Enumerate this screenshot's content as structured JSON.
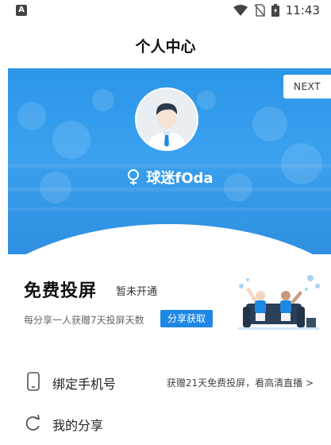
{
  "status_bar": {
    "time": "11:43",
    "left_icon": "notification-a-icon",
    "right_icons": [
      "wifi-icon",
      "no-sim-icon",
      "battery-charging-icon"
    ]
  },
  "header": {
    "title": "个人中心"
  },
  "banner": {
    "next_label": "NEXT",
    "username": "球迷fOda",
    "avatar_icon": "default-male-avatar-icon",
    "gender_icon": "female-symbol-icon",
    "colors": {
      "banner_blue": "#2b95e8",
      "accent": "#1e88e5"
    }
  },
  "promo": {
    "title": "免费投屏",
    "status": "暂未开通",
    "description": "每分享一人获赠7天投屏天数",
    "button_label": "分享获取",
    "illustration": "fans-on-sofa-illustration"
  },
  "list": {
    "bind_phone": {
      "icon": "phone-icon",
      "label": "绑定手机号",
      "hint": "获赠21天免费投屏，看高清直播 >"
    },
    "my_share": {
      "icon": "refresh-share-icon",
      "label": "我的分享"
    }
  }
}
